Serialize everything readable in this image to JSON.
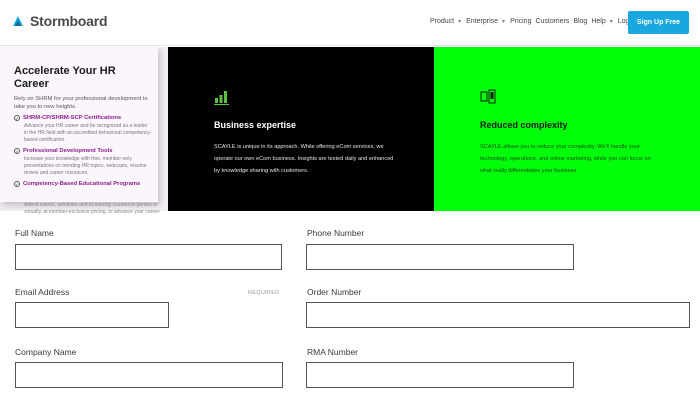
{
  "header": {
    "logo_text": "Stormboard",
    "nav": {
      "product": "Product",
      "enterprise": "Enterprise",
      "pricing": "Pricing",
      "customers": "Customers",
      "blog": "Blog",
      "help": "Help",
      "login": "Login →"
    },
    "signup_label": "Sign Up Free",
    "signup_color": "#1aa6de"
  },
  "promo": {
    "title": "Accelerate Your HR Career",
    "lead": "Rely on SHRM for your professional development to take you to new heights.",
    "items": [
      {
        "title": "SHRM-CP/SHRM-SCP Certifications",
        "text": "Advance your HR career and be recognized as a leader in the HR field with an accredited behavioral competency-based certification."
      },
      {
        "title": "Professional Development Tools",
        "text": "Increase your knowledge with free, member-only presentations on trending HR topics, webcasts, resume review and career resources."
      },
      {
        "title": "Competency-Based Educational Programs",
        "text": "Attend events, seminars and eLearning courses in person or virtually, at member-exclusive pricing, to advance your career."
      }
    ],
    "accent_color": "#8a1f8a"
  },
  "panels": {
    "black": {
      "icon": "bar-chart-icon",
      "title": "Business expertise",
      "text": "SCAYLE is unique in its approach. While offering eCom services, we operate our own eCom business. Insights are tested daily and enhanced by knowledge sharing with customers.",
      "bg_color": "#000000"
    },
    "green": {
      "icon": "devices-icon",
      "title": "Reduced complexity",
      "text": "SCAYLE allows you to reduce your complexity. We'll handle your technology, operations, and online marketing, while you can focus on what really differentiates your business.",
      "bg_color": "#00ff08"
    }
  },
  "form": {
    "full_name": {
      "label": "Full Name",
      "value": ""
    },
    "phone_number": {
      "label": "Phone Number",
      "value": ""
    },
    "email_address": {
      "label": "Email Address",
      "required": "REQUIRED",
      "value": ""
    },
    "order_number": {
      "label": "Order Number",
      "value": ""
    },
    "company_name": {
      "label": "Company Name",
      "value": ""
    },
    "rma_number": {
      "label": "RMA Number",
      "value": ""
    }
  }
}
